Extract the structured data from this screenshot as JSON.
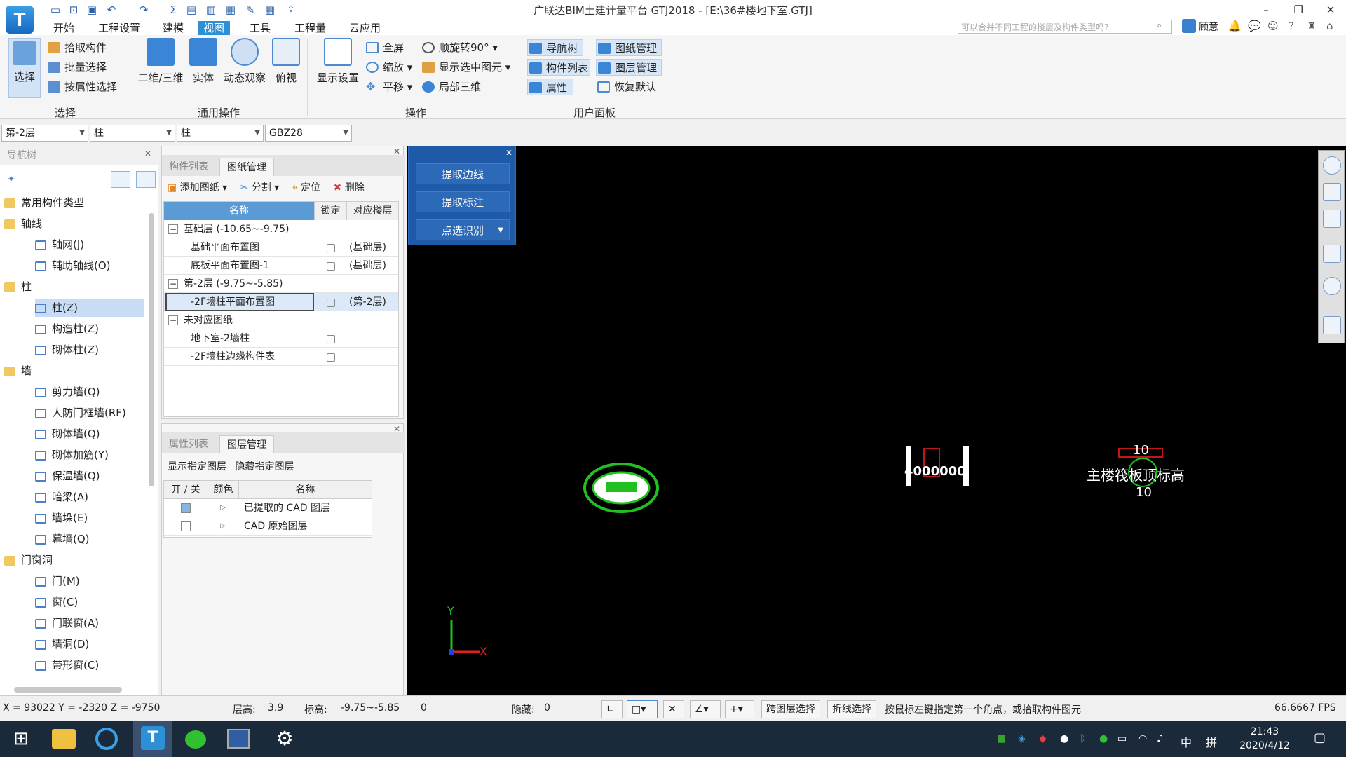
{
  "window": {
    "title": "广联达BIM土建计量平台 GTJ2018 - [E:\\36#楼地下室.GTJ]",
    "logo": "T"
  },
  "menu": [
    "开始",
    "工程设置",
    "建模",
    "视图",
    "工具",
    "工程量",
    "云应用"
  ],
  "menu_active": "视图",
  "search": {
    "placeholder": "可以合并不同工程的楼层及构件类型吗?"
  },
  "user": {
    "name": "顾意"
  },
  "ribbon": {
    "select_group": {
      "label": "选择",
      "big": "选择",
      "items": [
        "拾取构件",
        "批量选择",
        "按属性选择"
      ]
    },
    "common_ops": {
      "label": "通用操作",
      "items": [
        "二维/三维",
        "实体",
        "动态观察",
        "俯视"
      ]
    },
    "operations": {
      "label": "操作",
      "display": "显示设置",
      "items": [
        "全屏",
        "缩放",
        "平移",
        "顺旋转90°",
        "显示选中图元",
        "局部三维"
      ]
    },
    "user_panel": {
      "label": "用户面板",
      "items": [
        "导航树",
        "构件列表",
        "属性",
        "图纸管理",
        "图层管理",
        "恢复默认"
      ]
    }
  },
  "selectors": [
    "第-2层",
    "柱",
    "柱",
    "GBZ28"
  ],
  "nav": {
    "header": "导航树",
    "items": [
      {
        "label": "常用构件类型",
        "type": "folder",
        "level": 0
      },
      {
        "label": "轴线",
        "type": "folder",
        "level": 0
      },
      {
        "label": "轴网(J)",
        "type": "comp",
        "level": 1
      },
      {
        "label": "辅助轴线(O)",
        "type": "comp",
        "level": 1
      },
      {
        "label": "柱",
        "type": "folder",
        "level": 0
      },
      {
        "label": "柱(Z)",
        "type": "comp",
        "level": 1,
        "selected": true
      },
      {
        "label": "构造柱(Z)",
        "type": "comp",
        "level": 1
      },
      {
        "label": "砌体柱(Z)",
        "type": "comp",
        "level": 1
      },
      {
        "label": "墙",
        "type": "folder",
        "level": 0
      },
      {
        "label": "剪力墙(Q)",
        "type": "comp",
        "level": 1
      },
      {
        "label": "人防门框墙(RF)",
        "type": "comp",
        "level": 1
      },
      {
        "label": "砌体墙(Q)",
        "type": "comp",
        "level": 1
      },
      {
        "label": "砌体加筋(Y)",
        "type": "comp",
        "level": 1
      },
      {
        "label": "保温墙(Q)",
        "type": "comp",
        "level": 1
      },
      {
        "label": "暗梁(A)",
        "type": "comp",
        "level": 1
      },
      {
        "label": "墙垛(E)",
        "type": "comp",
        "level": 1
      },
      {
        "label": "幕墙(Q)",
        "type": "comp",
        "level": 1
      },
      {
        "label": "门窗洞",
        "type": "folder",
        "level": 0
      },
      {
        "label": "门(M)",
        "type": "comp",
        "level": 1
      },
      {
        "label": "窗(C)",
        "type": "comp",
        "level": 1
      },
      {
        "label": "门联窗(A)",
        "type": "comp",
        "level": 1
      },
      {
        "label": "墙洞(D)",
        "type": "comp",
        "level": 1
      },
      {
        "label": "带形窗(C)",
        "type": "comp",
        "level": 1
      }
    ]
  },
  "drawing_panel": {
    "tabs": [
      "构件列表",
      "图纸管理"
    ],
    "toolbar": [
      "添加图纸",
      "分割",
      "定位",
      "删除"
    ],
    "columns": [
      "名称",
      "锁定",
      "对应楼层"
    ],
    "rows": [
      {
        "name": "基础层 (-10.65~-9.75)",
        "group": true,
        "floor": ""
      },
      {
        "name": "基础平面布置图",
        "group": false,
        "floor": "(基础层)"
      },
      {
        "name": "底板平面布置图-1",
        "group": false,
        "floor": "(基础层)"
      },
      {
        "name": "第-2层 (-9.75~-5.85)",
        "group": true,
        "floor": ""
      },
      {
        "name": "-2F墙柱平面布置图",
        "group": false,
        "floor": "(第-2层)",
        "selected": true
      },
      {
        "name": "未对应图纸",
        "group": true,
        "floor": ""
      },
      {
        "name": "地下室-2墙柱",
        "group": false,
        "floor": ""
      },
      {
        "name": "-2F墙柱边缘构件表",
        "group": false,
        "floor": ""
      }
    ]
  },
  "layer_panel": {
    "tabs": [
      "属性列表",
      "图层管理"
    ],
    "toolbar": [
      "显示指定图层",
      "隐藏指定图层"
    ],
    "columns": [
      "开 / 关",
      "颜色",
      "名称"
    ],
    "rows": [
      {
        "name": "已提取的 CAD 图层",
        "on": true
      },
      {
        "name": "CAD 原始图层",
        "on": false
      }
    ]
  },
  "cad_panel": {
    "buttons": [
      "提取边线",
      "提取标注",
      "点选识别"
    ]
  },
  "canvas_text": {
    "label1": "主楼筏板顶标高",
    "num1": "10",
    "num2": "10",
    "axis_x": "X",
    "axis_y": "Y",
    "nums": "4000000"
  },
  "status": {
    "coords": "X = 93022 Y = -2320 Z = -9750",
    "floor_height_label": "层高:",
    "floor_height": "3.9",
    "elev_label": "标高:",
    "elev": "-9.75~-5.85",
    "zero": "0",
    "hidden_label": "隐藏:",
    "hidden": "0",
    "btn_cross_layer": "跨图层选择",
    "btn_polyline": "折线选择",
    "hint": "按鼠标左键指定第一个角点，或拾取构件图元",
    "fps": "66.6667 FPS"
  },
  "taskbar": {
    "time": "21:43",
    "date": "2020/4/12",
    "ime": "中",
    "ime2": "拼"
  },
  "colors": {
    "accent": "#2d8fd5",
    "canvas": "#000000",
    "cad_panel": "#1f5aa8",
    "taskbar": "#1b2a3b"
  }
}
